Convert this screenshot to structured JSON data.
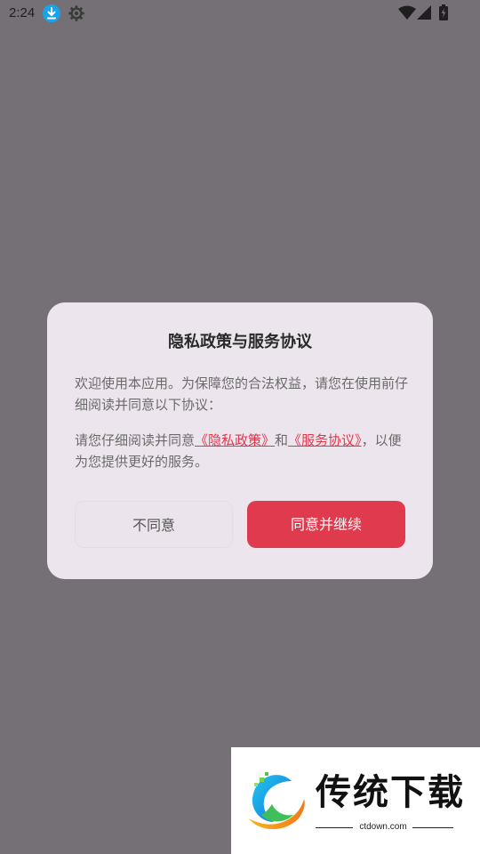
{
  "status_bar": {
    "time": "2:24",
    "icons": [
      "download-icon",
      "gear-icon",
      "wifi-icon",
      "signal-icon",
      "battery-icon"
    ]
  },
  "dialog": {
    "title": "隐私政策与服务协议",
    "intro": "欢迎使用本应用。为保障您的合法权益，请您在使用前仔细阅读并同意以下协议：",
    "consent_prefix": "请您仔细阅读并同意",
    "privacy_link": "《隐私政策》",
    "consent_and": "和",
    "service_link": "《服务协议》",
    "consent_suffix": "，以便为您提供更好的服务。",
    "disagree_label": "不同意",
    "agree_label": "同意并继续",
    "colors": {
      "accent": "#e03a4e",
      "background": "#ede5ed",
      "overlay": "#757075"
    }
  },
  "watermark": {
    "title": "传统下载",
    "url": "ctdown.com"
  }
}
